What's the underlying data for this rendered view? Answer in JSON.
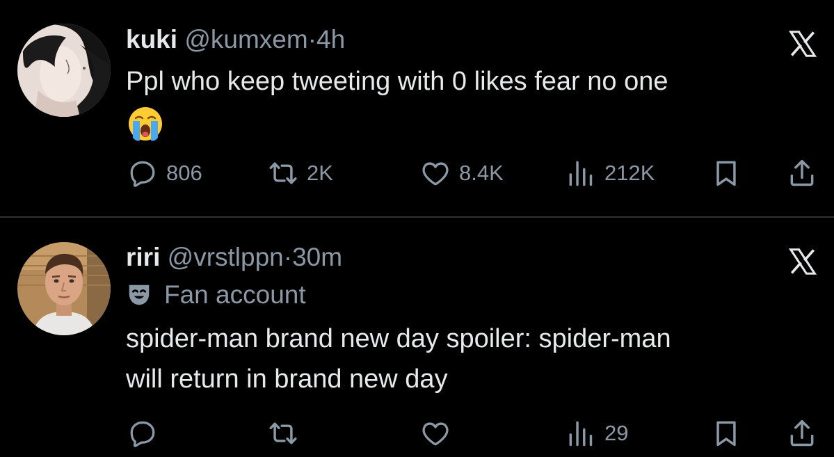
{
  "tweets": [
    {
      "display_name": "kuki",
      "handle": "@kumxem",
      "separator": "·",
      "time": "4h",
      "text": "Ppl who keep tweeting with 0 likes fear no one",
      "emoji": "loudly-crying-face",
      "stats": {
        "replies": "806",
        "reposts": "2K",
        "likes": "8.4K",
        "views": "212K"
      }
    },
    {
      "display_name": "riri",
      "handle": "@vrstlppn",
      "separator": "·",
      "time": "30m",
      "label": "Fan account",
      "text_lines": [
        "spider-man brand new day spoiler: spider-man",
        "will return in brand new day"
      ],
      "stats": {
        "replies": "",
        "reposts": "",
        "likes": "",
        "views": "29"
      }
    }
  ],
  "icons": {
    "platform": "x-logo-icon",
    "reply": "reply-icon",
    "repost": "repost-icon",
    "like": "heart-icon",
    "views": "views-icon",
    "bookmark": "bookmark-icon",
    "share": "share-icon",
    "fan_account": "theater-mask-icon"
  },
  "colors": {
    "background": "#000000",
    "primary_text": "#e7e9ea",
    "secondary_text": "#8b98a5",
    "divider": "#2f3336"
  }
}
